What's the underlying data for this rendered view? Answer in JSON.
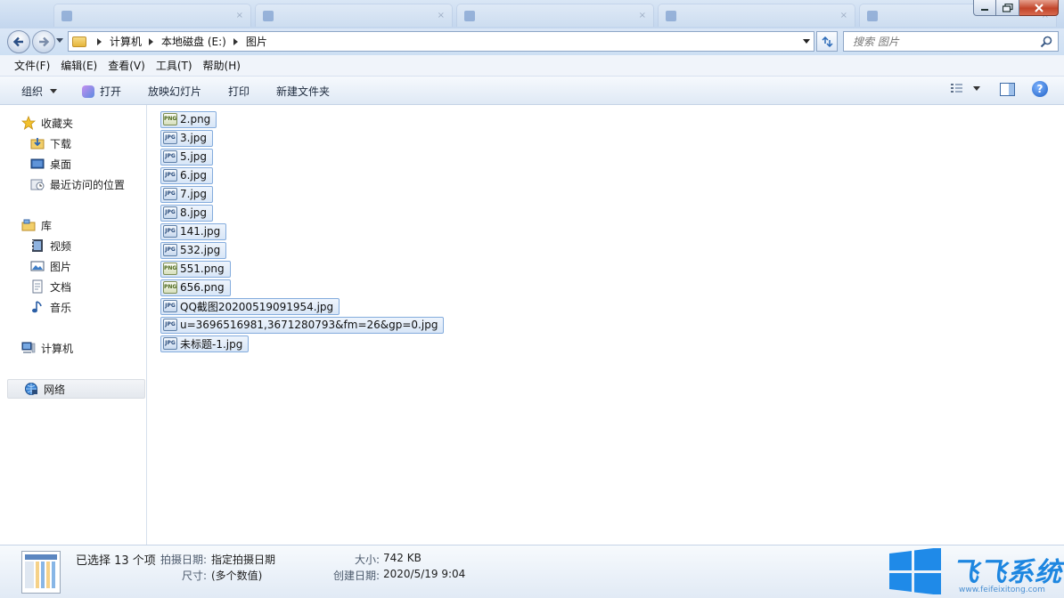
{
  "window": {
    "colors": {
      "accent": "#1d5fc4",
      "titlebar": "#c3d6ee",
      "close": "#c2452a",
      "selection": "#d8e6f7"
    }
  },
  "address": {
    "crumbs": [
      "计算机",
      "本地磁盘 (E:)",
      "图片"
    ]
  },
  "search": {
    "placeholder": "搜索 图片"
  },
  "menu": {
    "items": [
      "文件(F)",
      "编辑(E)",
      "查看(V)",
      "工具(T)",
      "帮助(H)"
    ]
  },
  "toolbar": {
    "organize": "组织",
    "open": "打开",
    "slideshow": "放映幻灯片",
    "print": "打印",
    "new_folder": "新建文件夹"
  },
  "nav": {
    "favorites": {
      "label": "收藏夹",
      "icon": "star-icon"
    },
    "favorites_items": [
      {
        "label": "下载",
        "icon": "downloads-icon"
      },
      {
        "label": "桌面",
        "icon": "desktop-icon"
      },
      {
        "label": "最近访问的位置",
        "icon": "recent-places-icon"
      }
    ],
    "libraries": {
      "label": "库",
      "icon": "library-icon"
    },
    "libraries_items": [
      {
        "label": "视频",
        "icon": "video-icon"
      },
      {
        "label": "图片",
        "icon": "pictures-icon"
      },
      {
        "label": "文档",
        "icon": "documents-icon"
      },
      {
        "label": "音乐",
        "icon": "music-icon"
      }
    ],
    "computer": {
      "label": "计算机",
      "icon": "computer-icon"
    },
    "network": {
      "label": "网络",
      "icon": "network-icon"
    }
  },
  "files": [
    {
      "name": "2.png",
      "type": "png"
    },
    {
      "name": "3.jpg",
      "type": "jpg"
    },
    {
      "name": "5.jpg",
      "type": "jpg"
    },
    {
      "name": "6.jpg",
      "type": "jpg"
    },
    {
      "name": "7.jpg",
      "type": "jpg"
    },
    {
      "name": "8.jpg",
      "type": "jpg"
    },
    {
      "name": "141.jpg",
      "type": "jpg"
    },
    {
      "name": "532.jpg",
      "type": "jpg"
    },
    {
      "name": "551.png",
      "type": "png"
    },
    {
      "name": "656.png",
      "type": "png"
    },
    {
      "name": "QQ截图20200519091954.jpg",
      "type": "jpg"
    },
    {
      "name": "u=3696516981,3671280793&fm=26&gp=0.jpg",
      "type": "jpg"
    },
    {
      "name": "未标题-1.jpg",
      "type": "jpg"
    }
  ],
  "details": {
    "selection": "已选择 13 个项",
    "date_taken_label": "拍摄日期:",
    "date_taken_value": "指定拍摄日期",
    "dimensions_label": "尺寸:",
    "dimensions_value": "(多个数值)",
    "size_label": "大小:",
    "size_value": "742 KB",
    "created_label": "创建日期:",
    "created_value": "2020/5/19 9:04"
  },
  "watermark": {
    "title": "飞飞系统",
    "url": "www.feifeixitong.com"
  }
}
